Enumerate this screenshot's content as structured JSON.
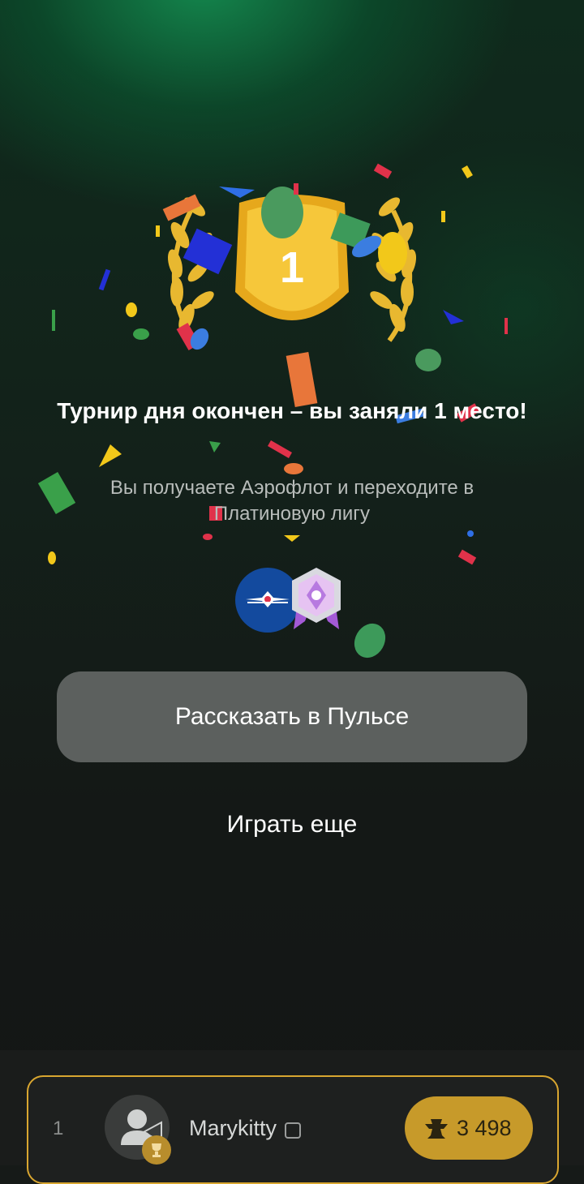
{
  "result": {
    "title": "Турнир дня окончен – вы заняли 1 место!",
    "subtitle": "Вы получаете Аэрофлот и переходите в Платиновую лигу",
    "place_number": "1",
    "rewards": [
      {
        "icon": "aeroflot-logo-icon",
        "color": "#134a9e"
      },
      {
        "icon": "platinum-league-badge-icon",
        "color": "#b78ce0"
      }
    ]
  },
  "actions": {
    "share_label": "Рассказать в Пульсе",
    "play_again_label": "Играть еще"
  },
  "leaderboard": {
    "rank": "1",
    "player_name": "Marykitty",
    "score": "3 498",
    "score_icon": "anvil-icon",
    "avatar_icon": "user-placeholder-icon",
    "avatar_badge_icon": "trophy-icon"
  },
  "colors": {
    "accent_gold": "#d9a630",
    "button_gray": "#5c605e",
    "bg_green": "#148c50"
  }
}
